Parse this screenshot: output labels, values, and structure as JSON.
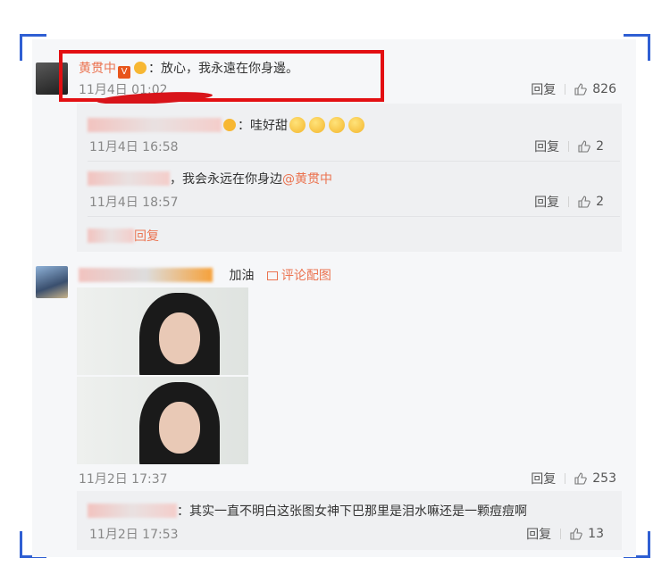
{
  "comment1": {
    "author": "黄贯中",
    "text": "：放心，我永遠在你身邊。",
    "time": "11月4日 01:02",
    "reply_label": "回复",
    "likes": "826",
    "replies": [
      {
        "text": "：哇好甜",
        "time": "11月4日 16:58",
        "reply_label": "回复",
        "likes": "2"
      },
      {
        "text": "，我会永远在你身边",
        "mention": "@黄贯中",
        "time": "11月4日 18:57",
        "reply_label": "回复",
        "likes": "2"
      }
    ],
    "more_replies": "回复"
  },
  "comment2": {
    "text": "加油",
    "pic_link": "评论配图",
    "time": "11月2日 17:37",
    "reply_label": "回复",
    "likes": "253",
    "reply": {
      "text": "：其实一直不明白这张图女神下巴那里是泪水嘛还是一颗痘痘啊",
      "time": "11月2日 17:53",
      "reply_label": "回复",
      "likes": "13"
    }
  },
  "colors": {
    "accent": "#eb7350",
    "highlight": "#e30f12",
    "corner": "#2f5fd3"
  }
}
